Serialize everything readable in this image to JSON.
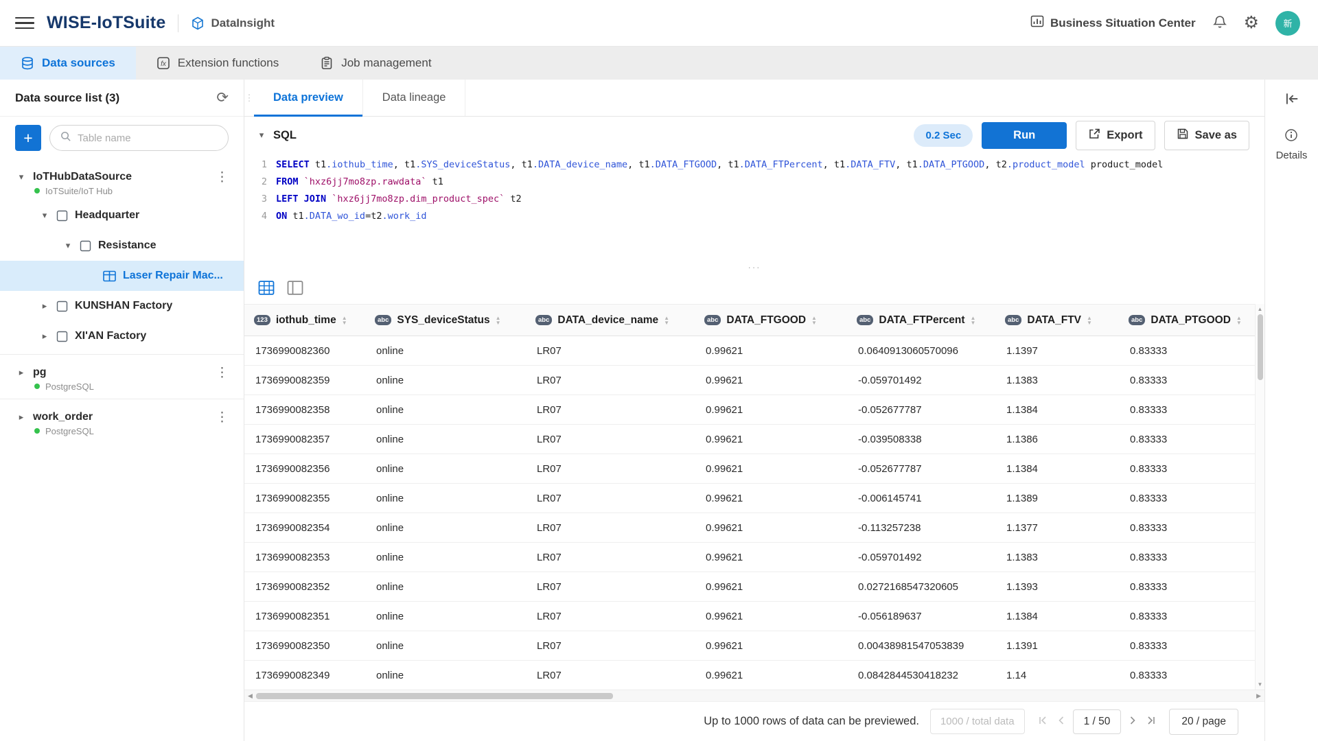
{
  "header": {
    "app_title": "WISE-IoTSuite",
    "module_name": "DataInsight",
    "business_center_label": "Business Situation Center",
    "avatar_text": "新"
  },
  "nav_tabs": [
    {
      "label": "Data sources",
      "icon": "database",
      "active": true
    },
    {
      "label": "Extension functions",
      "icon": "extension",
      "active": false
    },
    {
      "label": "Job management",
      "icon": "clipboard",
      "active": false
    }
  ],
  "sidebar": {
    "title": "Data source list (3)",
    "add_button": "+",
    "search_placeholder": "Table name",
    "tree": [
      {
        "type": "source",
        "label": "IoTHubDataSource",
        "subtitle": "IoTSuite/IoT Hub",
        "level": 0,
        "expanded": true,
        "menu": true
      },
      {
        "type": "folder",
        "label": "Headquarter",
        "level": 1,
        "expanded": true
      },
      {
        "type": "folder",
        "label": "Resistance",
        "level": 2,
        "expanded": true
      },
      {
        "type": "table",
        "label": "Laser Repair Mac...",
        "level": 3,
        "selected": true
      },
      {
        "type": "folder",
        "label": "KUNSHAN Factory",
        "level": 1,
        "expanded": false
      },
      {
        "type": "folder",
        "label": "XI'AN Factory",
        "level": 1,
        "expanded": false
      },
      {
        "type": "source",
        "label": "pg",
        "subtitle": "PostgreSQL",
        "level": 0,
        "expanded": false,
        "menu": true,
        "divider": true
      },
      {
        "type": "source",
        "label": "work_order",
        "subtitle": "PostgreSQL",
        "level": 0,
        "expanded": false,
        "menu": true,
        "divider": true
      }
    ]
  },
  "main": {
    "tabs": [
      {
        "label": "Data preview",
        "active": true
      },
      {
        "label": "Data lineage",
        "active": false
      }
    ],
    "sql": {
      "section_label": "SQL",
      "time_badge": "0.2 Sec",
      "run_label": "Run",
      "export_label": "Export",
      "save_as_label": "Save as",
      "lines": [
        [
          {
            "t": "kw",
            "v": "SELECT"
          },
          {
            "t": "p",
            "v": " t1"
          },
          {
            "t": "c",
            "v": ".iothub_time"
          },
          {
            "t": "p",
            "v": ", t1"
          },
          {
            "t": "c",
            "v": ".SYS_deviceStatus"
          },
          {
            "t": "p",
            "v": ", t1"
          },
          {
            "t": "c",
            "v": ".DATA_device_name"
          },
          {
            "t": "p",
            "v": ", t1"
          },
          {
            "t": "c",
            "v": ".DATA_FTGOOD"
          },
          {
            "t": "p",
            "v": ", t1"
          },
          {
            "t": "c",
            "v": ".DATA_FTPercent"
          },
          {
            "t": "p",
            "v": ", t1"
          },
          {
            "t": "c",
            "v": ".DATA_FTV"
          },
          {
            "t": "p",
            "v": ", t1"
          },
          {
            "t": "c",
            "v": ".DATA_PTGOOD"
          },
          {
            "t": "p",
            "v": ", t2"
          },
          {
            "t": "c",
            "v": ".product_model"
          },
          {
            "t": "p",
            "v": " product_model"
          }
        ],
        [
          {
            "t": "kw",
            "v": "FROM"
          },
          {
            "t": "s",
            "v": " `hxz6jj7mo8zp.rawdata`"
          },
          {
            "t": "p",
            "v": " t1"
          }
        ],
        [
          {
            "t": "kw",
            "v": "LEFT JOIN"
          },
          {
            "t": "s",
            "v": " `hxz6jj7mo8zp.dim_product_spec`"
          },
          {
            "t": "p",
            "v": " t2"
          }
        ],
        [
          {
            "t": "kw",
            "v": "ON"
          },
          {
            "t": "p",
            "v": " t1"
          },
          {
            "t": "c",
            "v": ".DATA_wo_id"
          },
          {
            "t": "p",
            "v": "=t2"
          },
          {
            "t": "c",
            "v": ".work_id"
          }
        ]
      ]
    },
    "table": {
      "columns": [
        {
          "label": "iothub_time",
          "icon": "123"
        },
        {
          "label": "SYS_deviceStatus",
          "icon": "abc"
        },
        {
          "label": "DATA_device_name",
          "icon": "abc"
        },
        {
          "label": "DATA_FTGOOD",
          "icon": "abc"
        },
        {
          "label": "DATA_FTPercent",
          "icon": "abc"
        },
        {
          "label": "DATA_FTV",
          "icon": "abc"
        },
        {
          "label": "DATA_PTGOOD",
          "icon": "abc"
        }
      ],
      "rows": [
        [
          "1736990082360",
          "online",
          "LR07",
          "0.99621",
          "0.0640913060570096",
          "1.1397",
          "0.83333"
        ],
        [
          "1736990082359",
          "online",
          "LR07",
          "0.99621",
          "-0.059701492",
          "1.1383",
          "0.83333"
        ],
        [
          "1736990082358",
          "online",
          "LR07",
          "0.99621",
          "-0.052677787",
          "1.1384",
          "0.83333"
        ],
        [
          "1736990082357",
          "online",
          "LR07",
          "0.99621",
          "-0.039508338",
          "1.1386",
          "0.83333"
        ],
        [
          "1736990082356",
          "online",
          "LR07",
          "0.99621",
          "-0.052677787",
          "1.1384",
          "0.83333"
        ],
        [
          "1736990082355",
          "online",
          "LR07",
          "0.99621",
          "-0.006145741",
          "1.1389",
          "0.83333"
        ],
        [
          "1736990082354",
          "online",
          "LR07",
          "0.99621",
          "-0.113257238",
          "1.1377",
          "0.83333"
        ],
        [
          "1736990082353",
          "online",
          "LR07",
          "0.99621",
          "-0.059701492",
          "1.1383",
          "0.83333"
        ],
        [
          "1736990082352",
          "online",
          "LR07",
          "0.99621",
          "0.0272168547320605",
          "1.1393",
          "0.83333"
        ],
        [
          "1736990082351",
          "online",
          "LR07",
          "0.99621",
          "-0.056189637",
          "1.1384",
          "0.83333"
        ],
        [
          "1736990082350",
          "online",
          "LR07",
          "0.99621",
          "0.00438981547053839",
          "1.1391",
          "0.83333"
        ],
        [
          "1736990082349",
          "online",
          "LR07",
          "0.99621",
          "0.0842844530418232",
          "1.14",
          "0.83333"
        ]
      ]
    },
    "footer": {
      "note": "Up to 1000 rows of data can be previewed.",
      "total_label": "1000 / total data",
      "page_indicator": "1 / 50",
      "page_size": "20 / page"
    }
  },
  "right_panel": {
    "details_label": "Details"
  },
  "icons": {
    "refresh": "⟳",
    "settings_gear": "⚙",
    "more_menu": "⋮",
    "caret_down": "▾",
    "caret_right": "▸",
    "sort_up": "▲",
    "sort_down": "▼",
    "resize_dots": "···",
    "drag_dots": "⋮",
    "scroll_up": "▲",
    "scroll_down": "▼",
    "scroll_left": "◀",
    "scroll_right": "▶"
  },
  "colors": {
    "accent": "#0d73d8",
    "brand_navy": "#16386b",
    "run_button": "#1273d4",
    "avatar_bg": "#2fb3a7",
    "status_green": "#35c24d",
    "sql_keyword": "#0000c4",
    "sql_column": "#2f54d8",
    "sql_string": "#9e1068",
    "column_badge": "#546072",
    "selected_row_bg": "#d9ecfb",
    "tab_active_bg": "#e0eefb",
    "time_badge_bg": "#dcebfa"
  }
}
